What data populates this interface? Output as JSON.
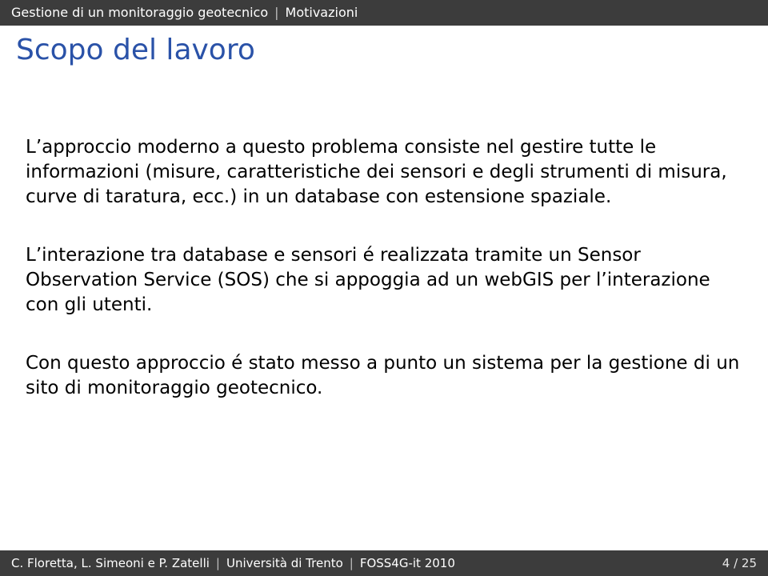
{
  "topbar": {
    "section": "Gestione di un monitoraggio geotecnico",
    "subsection": "Motivazioni"
  },
  "title": "Scopo del lavoro",
  "paragraphs": {
    "p1": "L’approccio moderno a questo problema consiste nel gestire tutte le informazioni (misure, caratteristiche dei sensori e degli strumenti di misura, curve di taratura, ecc.) in un database con estensione spaziale.",
    "p2": "L’interazione tra database e sensori é realizzata tramite un Sensor Observation Service (SOS) che si appoggia ad un webGIS per l’interazione con gli utenti.",
    "p3": "Con questo approccio é stato messo a punto un sistema per la gestione di un sito di monitoraggio geotecnico."
  },
  "footer": {
    "authors": "C. Floretta, L. Simeoni e P. Zatelli",
    "affiliation": "Università di Trento",
    "event": "FOSS4G-it 2010",
    "page": "4 / 25"
  }
}
